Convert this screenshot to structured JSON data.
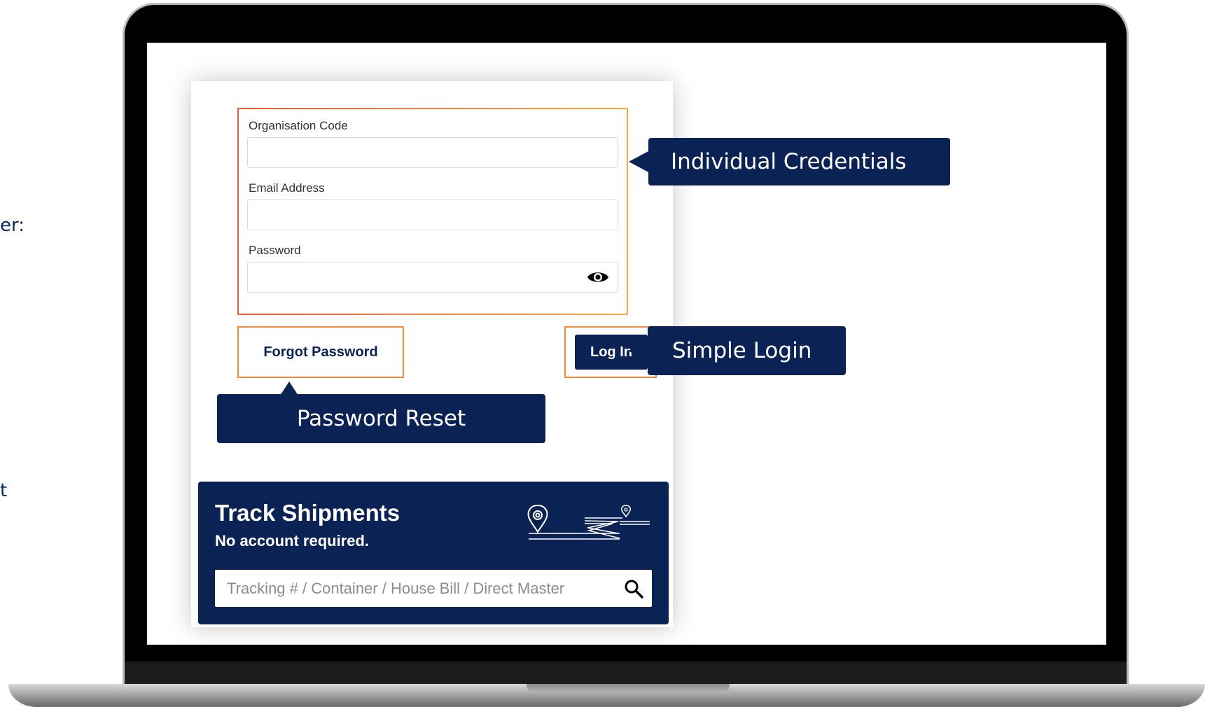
{
  "page_edge": {
    "partial_text_1": "er:",
    "partial_text_2": "t"
  },
  "login_form": {
    "org_code_label": "Organisation Code",
    "org_code_value": "",
    "email_label": "Email Address",
    "email_value": "",
    "password_label": "Password",
    "password_value": "",
    "password_toggle_icon": "eye-icon",
    "forgot_password_label": "Forgot Password",
    "login_button_label": "Log In"
  },
  "tracking": {
    "title": "Track Shipments",
    "subtitle": "No account required.",
    "placeholder": "Tracking # / Container / House Bill / Direct Master",
    "search_icon": "search-icon",
    "graphic_icon": "map-pin-route-icon"
  },
  "callouts": {
    "credentials": "Individual Credentials",
    "simple_login": "Simple Login",
    "password_reset": "Password Reset"
  },
  "colors": {
    "navy": "#0b2255",
    "highlight_orange": "#f28a3c",
    "highlight_red": "#f05a3c"
  }
}
